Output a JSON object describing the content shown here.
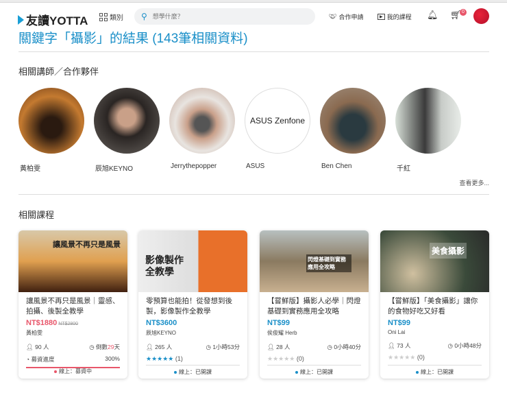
{
  "header": {
    "logo": "友讀YOTTA",
    "category": "類別",
    "search_placeholder": "想學什麼？",
    "partner": "合作申請",
    "my_courses": "我的課程",
    "cart_count": "0"
  },
  "title": "關鍵字「攝影」的結果 (143筆相關資料)",
  "instructors_heading": "相關講師／合作夥伴",
  "instructors": [
    {
      "name": "黃柏雯"
    },
    {
      "name": "辰旭KEYNO"
    },
    {
      "name": "Jerrythepopper"
    },
    {
      "name": "ASUS",
      "logo_text": "ASUS Zenfone"
    },
    {
      "name": "Ben Chen"
    },
    {
      "name": "千紅"
    }
  ],
  "more": "查看更多...",
  "courses_heading": "相關課程",
  "courses": [
    {
      "img_text": "讓風景不再只是風景",
      "title": "讓風景不再只是風景｜靈感、拍攝、後製全教學",
      "price": "NT$1880",
      "orig": "NT$2800",
      "author": "黃柏雯",
      "students": "90 人",
      "time_prefix": "倒數",
      "time_num": "29",
      "time_suffix": "天",
      "progress_label": "募資進度",
      "progress_value": "300%",
      "status": "線上：募資中"
    },
    {
      "img_text": "影像製作全教學",
      "title": "零預算也能拍！從發想到後製，影像製作全教學",
      "price": "NT$3600",
      "author": "辰旭KEYNO",
      "students": "265 人",
      "time": "1小時53分",
      "stars": "★★★★★",
      "reviews": "(1)",
      "status": "線上：已開課"
    },
    {
      "img_text": "閃燈基礎到實務應用全攻略",
      "title": "【嘗鮮版】攝影人必學｜閃燈基礎到實務應用全攻略",
      "price": "NT$99",
      "author": "侯俊耀 Herb",
      "students": "28 人",
      "time": "0小時40分",
      "stars": "★★★★★",
      "reviews": "(0)",
      "status": "線上：已開課"
    },
    {
      "img_text": "美食攝影",
      "title": "【嘗鮮版】「美食攝影」讓你的食物好吃又好看",
      "price": "NT$99",
      "author": "Oni Lai",
      "students": "73 人",
      "time": "0小時48分",
      "stars": "★★★★★",
      "reviews": "(0)",
      "status": "線上：已開課"
    }
  ],
  "colors": {
    "accent": "#1a8fc8",
    "sale": "#e8566a",
    "star": "#1a8fc8"
  }
}
